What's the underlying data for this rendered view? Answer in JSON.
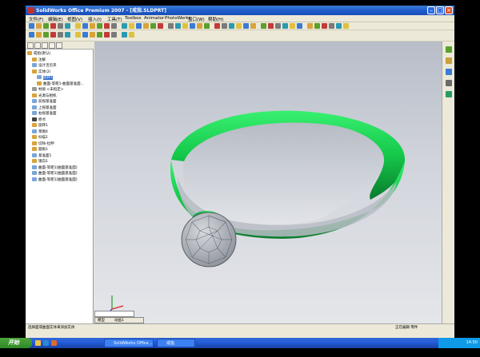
{
  "titlebar": {
    "title": "SolidWorks Office Premium 2007 - [戒指.SLDPRT]"
  },
  "menu": [
    "文件(F)",
    "编辑(E)",
    "视图(V)",
    "插入(I)",
    "工具(T)",
    "Toolbox",
    "Animator",
    "PhotoWorks",
    "窗口(W)",
    "帮助(H)"
  ],
  "tree": [
    {
      "label": "戒指(默认)",
      "level": 0,
      "icon": "part-icon",
      "color": "#d8a33a"
    },
    {
      "label": "注解",
      "level": 1,
      "icon": "annotation-icon",
      "color": "#d8a33a"
    },
    {
      "label": "设计活页夹",
      "level": 1,
      "icon": "binder-icon",
      "color": "#7aa5d8"
    },
    {
      "label": "实体(2)",
      "level": 1,
      "icon": "solid-bodies-icon",
      "color": "#d8a33a"
    },
    {
      "label": "旋转1",
      "level": 2,
      "icon": "body-icon",
      "color": "#7aa5d8",
      "selected": true
    },
    {
      "label": "曲面-等距1-曲面基准面...",
      "level": 2,
      "icon": "body-icon",
      "color": "#d8a33a"
    },
    {
      "label": "材质 <未指定>",
      "level": 1,
      "icon": "material-icon",
      "color": "#999999"
    },
    {
      "label": "光源与相机",
      "level": 1,
      "icon": "lights-icon",
      "color": "#d8a33a"
    },
    {
      "label": "前视基准面",
      "level": 1,
      "icon": "plane-icon",
      "color": "#7aa5d8"
    },
    {
      "label": "上视基准面",
      "level": 1,
      "icon": "plane-icon",
      "color": "#7aa5d8"
    },
    {
      "label": "右视基准面",
      "level": 1,
      "icon": "plane-icon",
      "color": "#7aa5d8"
    },
    {
      "label": "原点",
      "level": 1,
      "icon": "origin-icon",
      "color": "#444444"
    },
    {
      "label": "旋转1",
      "level": 1,
      "icon": "feature-icon",
      "color": "#d8a33a"
    },
    {
      "label": "草图4",
      "level": 1,
      "icon": "sketch-icon",
      "color": "#7aa5d8"
    },
    {
      "label": "扫描1",
      "level": 1,
      "icon": "feature-icon",
      "color": "#d8a33a"
    },
    {
      "label": "切除-拉伸",
      "level": 1,
      "icon": "feature-icon",
      "color": "#d8a33a"
    },
    {
      "label": "圆角1",
      "level": 1,
      "icon": "feature-icon",
      "color": "#d8a33a"
    },
    {
      "label": "基准面1",
      "level": 1,
      "icon": "plane-icon",
      "color": "#7aa5d8"
    },
    {
      "label": "镜向1",
      "level": 1,
      "icon": "feature-icon",
      "color": "#d8a33a"
    },
    {
      "label": "曲面-等距1[曲面基准面]",
      "level": 1,
      "icon": "surface-icon",
      "color": "#7aa5d8"
    },
    {
      "label": "曲面-等距1[曲面基准面]",
      "level": 1,
      "icon": "surface-icon",
      "color": "#7aa5d8"
    },
    {
      "label": "曲面-等距1[曲面基准面]",
      "level": 1,
      "icon": "surface-icon",
      "color": "#7aa5d8"
    }
  ],
  "viewport": {
    "ring_color": "#1fd45a",
    "gem_color": "#a9adb6"
  },
  "viewtabs": {
    "model_tab": "模型",
    "motion_tab": "动画1"
  },
  "statusbar": {
    "left": "选择面或曲面实体来添加实体",
    "editing": "正在编辑 零件"
  },
  "taskbar": {
    "start": "开始",
    "tasks": [
      "SolidWorks Office ...",
      "戒指"
    ],
    "clock": "14:50"
  }
}
